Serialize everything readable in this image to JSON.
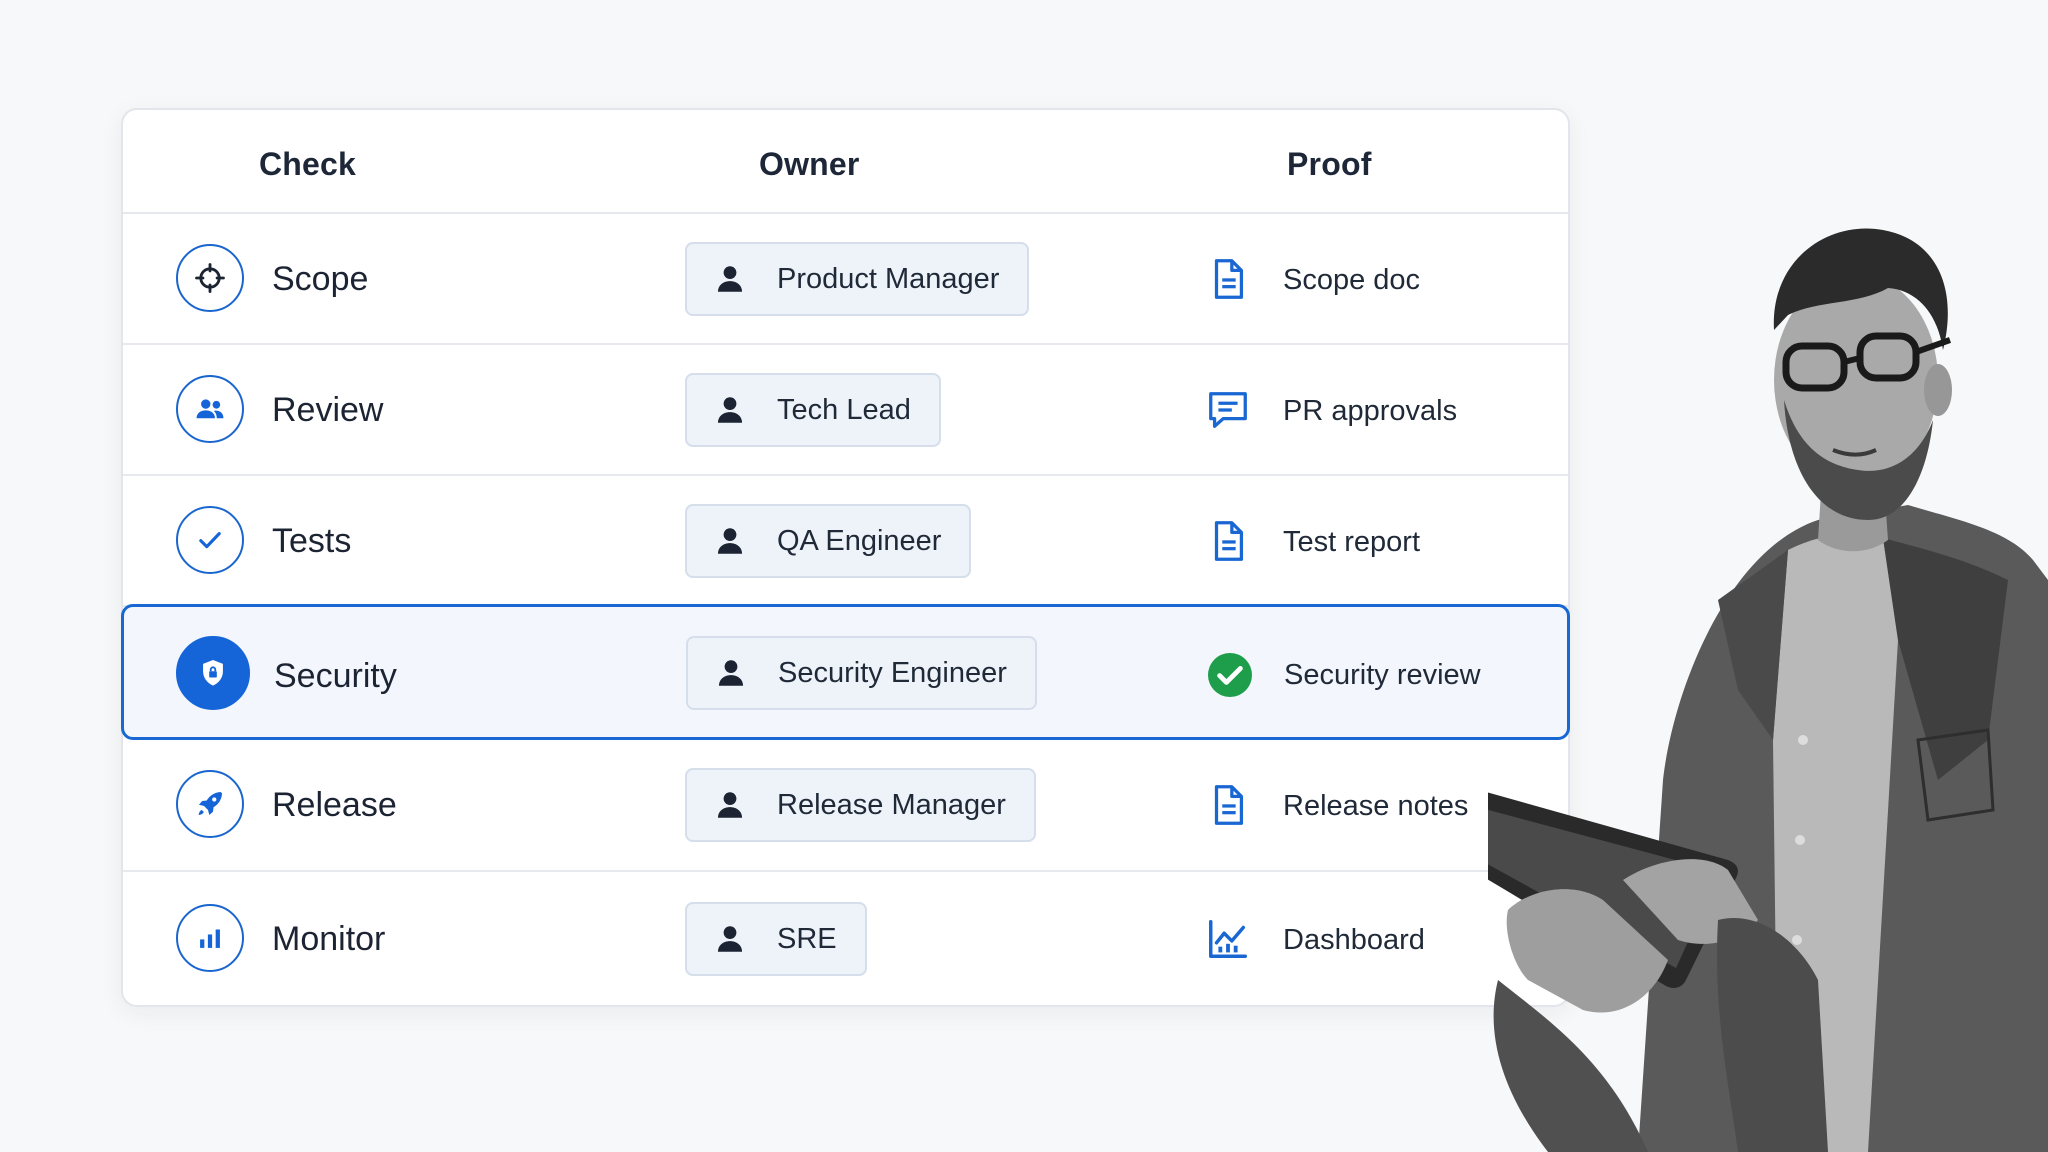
{
  "table": {
    "headers": {
      "check": "Check",
      "owner": "Owner",
      "proof": "Proof"
    },
    "rows": [
      {
        "check": "Scope",
        "check_icon": "target-icon",
        "owner": "Product Manager",
        "proof": "Scope doc",
        "proof_icon": "document-icon"
      },
      {
        "check": "Review",
        "check_icon": "people-icon",
        "owner": "Tech Lead",
        "proof": "PR approvals",
        "proof_icon": "comment-icon"
      },
      {
        "check": "Tests",
        "check_icon": "checkmark-icon",
        "owner": "QA Engineer",
        "proof": "Test report",
        "proof_icon": "document-icon"
      },
      {
        "check": "Security",
        "check_icon": "shield-lock-icon",
        "owner": "Security Engineer",
        "proof": "Security review",
        "proof_icon": "check-circle-icon",
        "highlighted": true
      },
      {
        "check": "Release",
        "check_icon": "rocket-icon",
        "owner": "Release Manager",
        "proof": "Release notes",
        "proof_icon": "document-icon"
      },
      {
        "check": "Monitor",
        "check_icon": "bar-chart-icon",
        "owner": "SRE",
        "proof": "Dashboard",
        "proof_icon": "line-chart-icon"
      }
    ]
  },
  "colors": {
    "accent": "#1967d2",
    "success": "#1e9e4a",
    "highlight_bg": "#f3f7fd",
    "chip_bg": "#eef3fa"
  }
}
